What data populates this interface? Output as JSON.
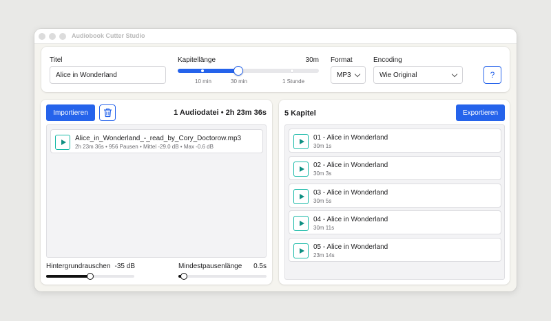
{
  "window": {
    "title": "Audiobook Cutter Studio"
  },
  "settings": {
    "title_label": "Titel",
    "title_value": "Alice in Wonderland",
    "chapter_length_label": "Kapitellänge",
    "chapter_length_value": "30m",
    "chapter_length_fraction": 0.43,
    "chapter_length_ticks": [
      "10 min",
      "30 min",
      "1 Stunde"
    ],
    "format_label": "Format",
    "format_value": "MP3",
    "encoding_label": "Encoding",
    "encoding_value": "Wie Original",
    "help_label": "?"
  },
  "left_panel": {
    "import_label": "Importieren",
    "delete_icon": "trash-icon",
    "summary": "1 Audiodatei • 2h 23m 36s",
    "files": [
      {
        "name": "Alice_in_Wonderland_-_read_by_Cory_Doctorow.mp3",
        "meta": "2h 23m 36s • 956 Pausen • Mittel -29.0 dB • Max -0.6 dB"
      }
    ],
    "noise_label": "Hintergrundrauschen",
    "noise_value": "-35 dB",
    "noise_fraction": 0.5,
    "pause_label": "Mindestpausenlänge",
    "pause_value": "0.5s",
    "pause_fraction": 0.06
  },
  "right_panel": {
    "count_label": "5 Kapitel",
    "export_label": "Exportieren",
    "chapters": [
      {
        "name": "01 - Alice in Wonderland",
        "duration": "30m 1s"
      },
      {
        "name": "02 - Alice in Wonderland",
        "duration": "30m 3s"
      },
      {
        "name": "03 - Alice in Wonderland",
        "duration": "30m 5s"
      },
      {
        "name": "04 - Alice in Wonderland",
        "duration": "30m 11s"
      },
      {
        "name": "05 - Alice in Wonderland",
        "duration": "23m 14s"
      }
    ]
  },
  "colors": {
    "accent": "#2563eb",
    "play": "#14b8a6",
    "background": "#e9e9e7"
  }
}
